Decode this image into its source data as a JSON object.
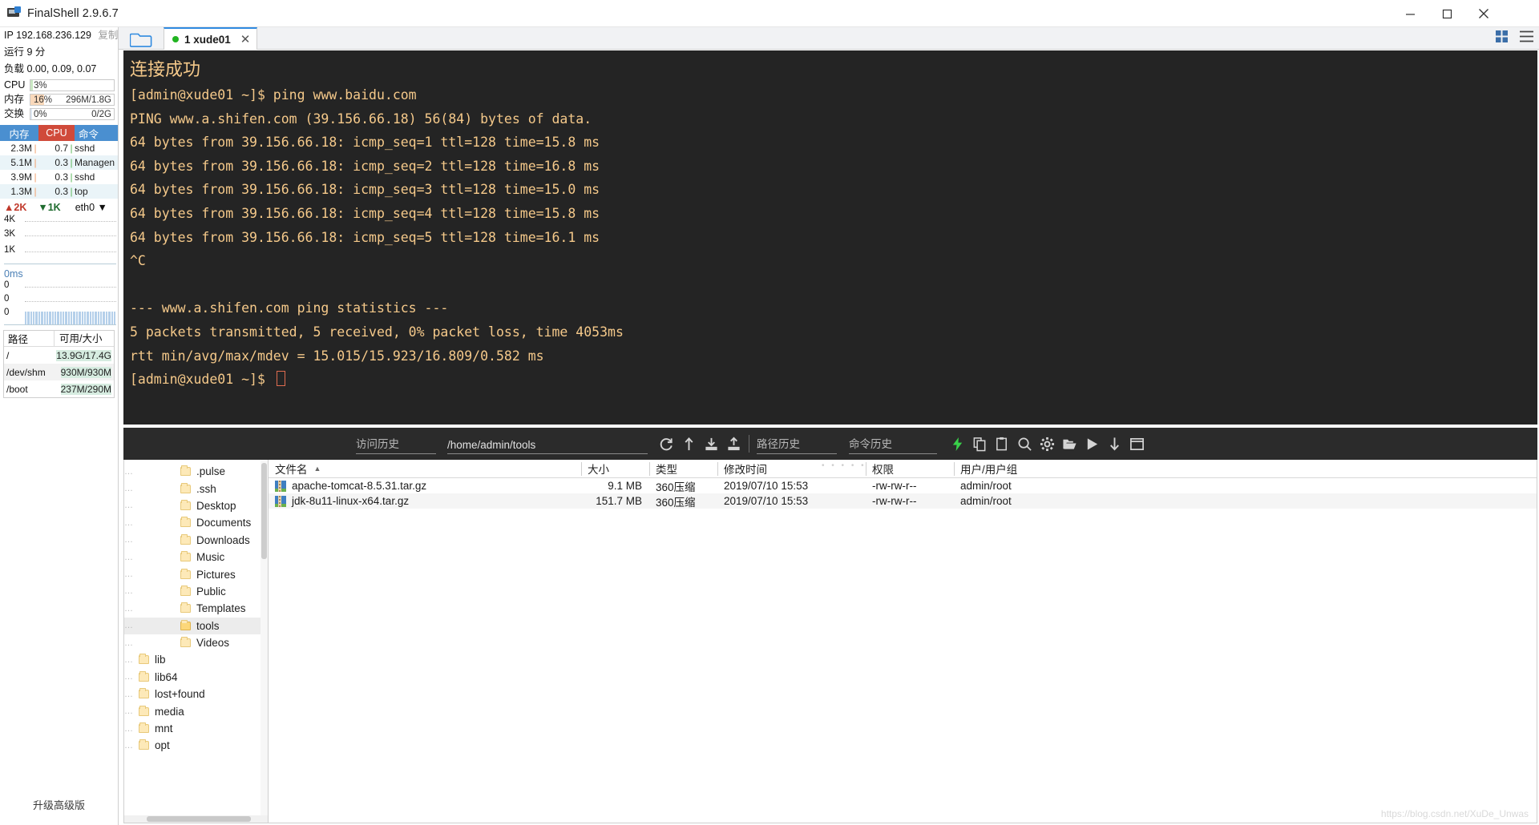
{
  "window": {
    "title": "FinalShell 2.9.6.7",
    "icon": "app-icon",
    "minimize": "minimize-icon",
    "maximize": "maximize-icon",
    "close": "close-icon"
  },
  "sidebar": {
    "ip_label": "IP",
    "ip_value": "192.168.236.129",
    "copy_label": "复制",
    "uptime_label": "运行",
    "uptime_value": "9 分",
    "load_label": "负载",
    "load_value": "0.00, 0.09, 0.07",
    "meters": [
      {
        "name": "CPU",
        "percent": "3%",
        "amount": "",
        "fill_pct": 3,
        "color": "#c9e7c2"
      },
      {
        "name": "内存",
        "percent": "16%",
        "amount": "296M/1.8G",
        "fill_pct": 16,
        "color": "#fad9bb"
      },
      {
        "name": "交换",
        "percent": "0%",
        "amount": "0/2G",
        "fill_pct": 0,
        "color": "#dde7f3"
      }
    ],
    "proc_headers": [
      "内存",
      "CPU",
      "命令"
    ],
    "proc_rows": [
      {
        "mem": "2.3M",
        "cpu": "0.7",
        "cmd": "sshd"
      },
      {
        "mem": "5.1M",
        "cpu": "0.3",
        "cmd": "Managen"
      },
      {
        "mem": "3.9M",
        "cpu": "0.3",
        "cmd": "sshd"
      },
      {
        "mem": "1.3M",
        "cpu": "0.3",
        "cmd": "top"
      }
    ],
    "net": {
      "up": "2K",
      "down": "1K",
      "interface": "eth0",
      "dropdown": "chevron-down-icon",
      "y_ticks": [
        "4K",
        "3K",
        "1K"
      ]
    },
    "latency": {
      "label": "0ms",
      "y_ticks": [
        "0",
        "0",
        "0"
      ]
    },
    "disk_headers": [
      "路径",
      "可用/大小"
    ],
    "disk_rows": [
      {
        "path": "/",
        "value": "13.9G/17.4G"
      },
      {
        "path": "/dev/shm",
        "value": "930M/930M"
      },
      {
        "path": "/boot",
        "value": "237M/290M"
      }
    ],
    "upgrade_label": "升级高级版"
  },
  "tabs": {
    "folder_icon": "open-folder-icon",
    "items": [
      {
        "label": "1 xude01",
        "status": "connected",
        "close": "close-icon"
      }
    ],
    "grid_icon": "grid-view-icon",
    "list_icon": "list-view-icon"
  },
  "terminal": {
    "lines": [
      {
        "text": "连接成功",
        "cjk": true
      },
      {
        "text": "[admin@xude01 ~]$ ping www.baidu.com"
      },
      {
        "text": "PING www.a.shifen.com (39.156.66.18) 56(84) bytes of data."
      },
      {
        "text": "64 bytes from 39.156.66.18: icmp_seq=1 ttl=128 time=15.8 ms"
      },
      {
        "text": "64 bytes from 39.156.66.18: icmp_seq=2 ttl=128 time=16.8 ms"
      },
      {
        "text": "64 bytes from 39.156.66.18: icmp_seq=3 ttl=128 time=15.0 ms"
      },
      {
        "text": "64 bytes from 39.156.66.18: icmp_seq=4 ttl=128 time=15.8 ms"
      },
      {
        "text": "64 bytes from 39.156.66.18: icmp_seq=5 ttl=128 time=16.1 ms"
      },
      {
        "text": "^C"
      },
      {
        "text": ""
      },
      {
        "text": "--- www.a.shifen.com ping statistics ---"
      },
      {
        "text": "5 packets transmitted, 5 received, 0% packet loss, time 4053ms"
      },
      {
        "text": "rtt min/avg/max/mdev = 15.015/15.923/16.809/0.582 ms"
      }
    ],
    "prompt": "[admin@xude01 ~]$ "
  },
  "fm_toolbar": {
    "visit_history_placeholder": "访问历史",
    "path_value": "/home/admin/tools",
    "path_history_placeholder": "路径历史",
    "command_history_placeholder": "命令历史",
    "icons_left": [
      "refresh-icon",
      "upload-arrow-icon",
      "download-icon",
      "upload-icon"
    ],
    "icons_right": [
      "lightning-icon",
      "copy-icon",
      "paste-icon",
      "search-icon",
      "gear-icon",
      "open-folder-icon",
      "play-icon",
      "download-arrow-icon",
      "window-icon"
    ]
  },
  "tree": {
    "nodes": [
      {
        "label": ".pulse",
        "indent": 2,
        "selected": false
      },
      {
        "label": ".ssh",
        "indent": 2,
        "selected": false
      },
      {
        "label": "Desktop",
        "indent": 2,
        "selected": false
      },
      {
        "label": "Documents",
        "indent": 2,
        "selected": false
      },
      {
        "label": "Downloads",
        "indent": 2,
        "selected": false
      },
      {
        "label": "Music",
        "indent": 2,
        "selected": false
      },
      {
        "label": "Pictures",
        "indent": 2,
        "selected": false
      },
      {
        "label": "Public",
        "indent": 2,
        "selected": false
      },
      {
        "label": "Templates",
        "indent": 2,
        "selected": false
      },
      {
        "label": "tools",
        "indent": 2,
        "selected": true
      },
      {
        "label": "Videos",
        "indent": 2,
        "selected": false
      },
      {
        "label": "lib",
        "indent": 1,
        "selected": false
      },
      {
        "label": "lib64",
        "indent": 1,
        "selected": false
      },
      {
        "label": "lost+found",
        "indent": 1,
        "selected": false
      },
      {
        "label": "media",
        "indent": 1,
        "selected": false
      },
      {
        "label": "mnt",
        "indent": 1,
        "selected": false
      },
      {
        "label": "opt",
        "indent": 1,
        "selected": false
      }
    ]
  },
  "filelist": {
    "headers": [
      {
        "label": "文件名",
        "sort": "asc"
      },
      {
        "label": "大小",
        "sort": ""
      },
      {
        "label": "类型",
        "sort": ""
      },
      {
        "label": "修改时间",
        "sort": ""
      },
      {
        "label": "权限",
        "sort": ""
      },
      {
        "label": "用户/用户组",
        "sort": ""
      }
    ],
    "rows": [
      {
        "name": "apache-tomcat-8.5.31.tar.gz",
        "size": "9.1 MB",
        "type": "360压缩",
        "mtime": "2019/07/10 15:53",
        "perm": "-rw-rw-r--",
        "owner": "admin/root"
      },
      {
        "name": "jdk-8u11-linux-x64.tar.gz",
        "size": "151.7 MB",
        "type": "360压缩",
        "mtime": "2019/07/10 15:53",
        "perm": "-rw-rw-r--",
        "owner": "admin/root"
      }
    ]
  },
  "watermark": "https://blog.csdn.net/XuDe_Unwas"
}
